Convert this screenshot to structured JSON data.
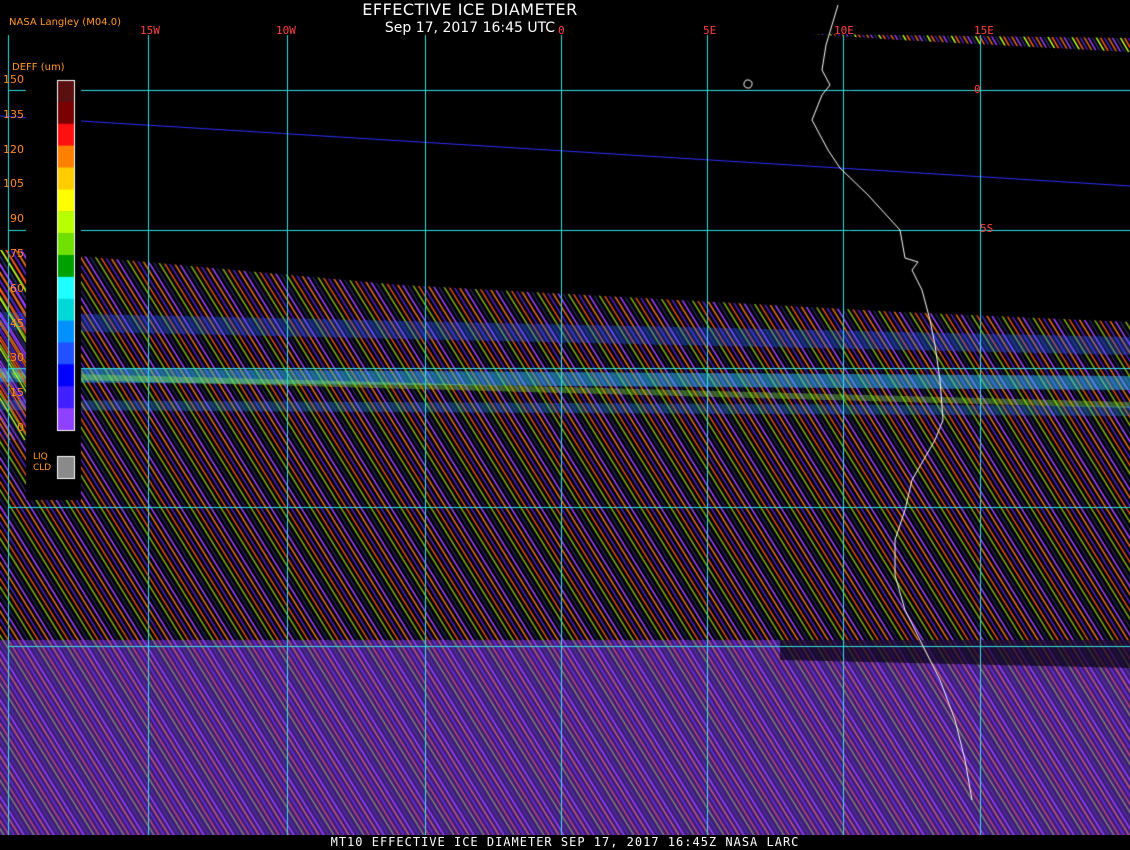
{
  "header": {
    "title": "EFFECTIVE ICE DIAMETER",
    "datetime": "Sep 17, 2017 16:45 UTC",
    "source": "NASA Langley (M04.0)"
  },
  "legend": {
    "title": "DEFF (um)",
    "ticks": [
      "150",
      "135",
      "120",
      "105",
      "90",
      "75",
      "60",
      "45",
      "30",
      "15",
      "0"
    ],
    "colors": [
      "#5a1010",
      "#7a0000",
      "#ff1010",
      "#ff8000",
      "#ffcc00",
      "#ffff00",
      "#b8ff00",
      "#70e000",
      "#00a000",
      "#20ffff",
      "#00d8d8",
      "#0090ff",
      "#2050ff",
      "#0000ff",
      "#4020ff",
      "#9040ff"
    ],
    "liq_cld_label": [
      "LIQ",
      "CLD"
    ],
    "liq_cld_color": "#8a8a8a"
  },
  "map": {
    "lon_labels": [
      "15W",
      "10W",
      "0",
      "5E",
      "10E",
      "15E"
    ],
    "lat_labels": [
      "0",
      "5S"
    ],
    "grid_color": "#30e0e0",
    "coast_color": "#ffffff",
    "track_color": "#3030ff",
    "stripe_colors": [
      "#e06a20",
      "#9b40ff",
      "#2a2a6a",
      "#c0ff20",
      "#ff5a20",
      "#5020c0"
    ]
  },
  "footer": {
    "text": "MT10  EFFECTIVE ICE DIAMETER  SEP 17, 2017 16:45Z  NASA LARC"
  }
}
